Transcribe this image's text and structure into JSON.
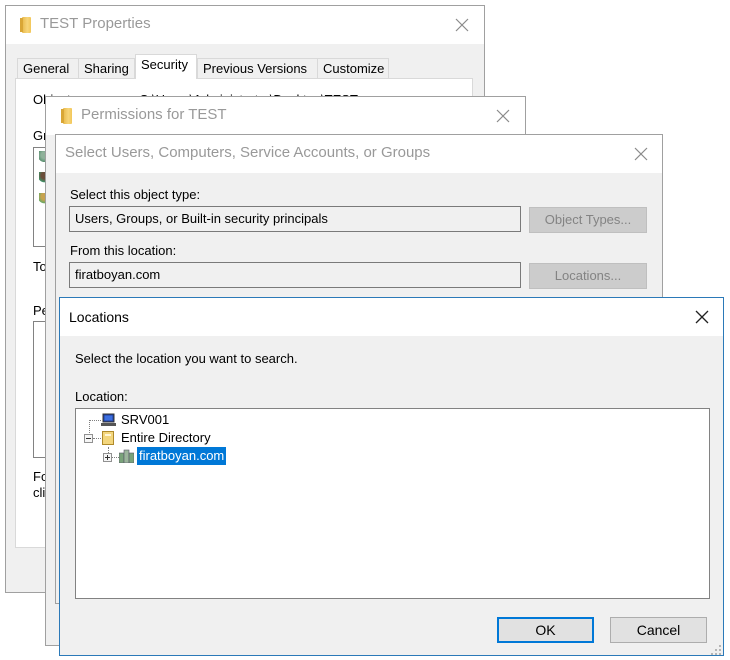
{
  "properties_window": {
    "title": "TEST Properties",
    "tabs": [
      {
        "label": "General",
        "active": false
      },
      {
        "label": "Sharing",
        "active": false
      },
      {
        "label": "Security",
        "active": true
      },
      {
        "label": "Previous Versions",
        "active": false
      },
      {
        "label": "Customize",
        "active": false
      }
    ],
    "object_name_label": "Object name:",
    "object_name_value": "C:\\Users\\Administrator\\Desktop\\TEST",
    "group_label_partial": "Gr",
    "to_label_partial": "To",
    "permissions_label_partial": "Pe",
    "footer_line1_partial": "Fo",
    "footer_line2_partial": "cli",
    "group_icons": [
      "user-group-icon",
      "user-icon",
      "user-icon"
    ]
  },
  "permissions_window": {
    "title": "Permissions for TEST"
  },
  "select_window": {
    "title": "Select Users, Computers, Service Accounts, or Groups",
    "object_type_label": "Select this object type:",
    "object_type_value": "Users, Groups, or Built-in security principals",
    "object_types_button": "Object Types...",
    "location_label": "From this location:",
    "location_value": "firatboyan.com",
    "locations_button": "Locations..."
  },
  "locations_window": {
    "title": "Locations",
    "instruction": "Select the location you want to search.",
    "location_label": "Location:",
    "tree": [
      {
        "label": "SRV001",
        "icon": "computer-icon",
        "level": 0,
        "expander": "none",
        "selected": false
      },
      {
        "label": "Entire Directory",
        "icon": "directory-icon",
        "level": 0,
        "expander": "expanded",
        "selected": false
      },
      {
        "label": "firatboyan.com",
        "icon": "domain-icon",
        "level": 1,
        "expander": "collapsed",
        "selected": true
      }
    ],
    "ok_button": "OK",
    "cancel_button": "Cancel"
  },
  "colors": {
    "accent": "#0078d7",
    "active_window_border": "#2b79b8",
    "inactive_title_text": "#999999",
    "dialog_background": "#f0f0f0"
  }
}
